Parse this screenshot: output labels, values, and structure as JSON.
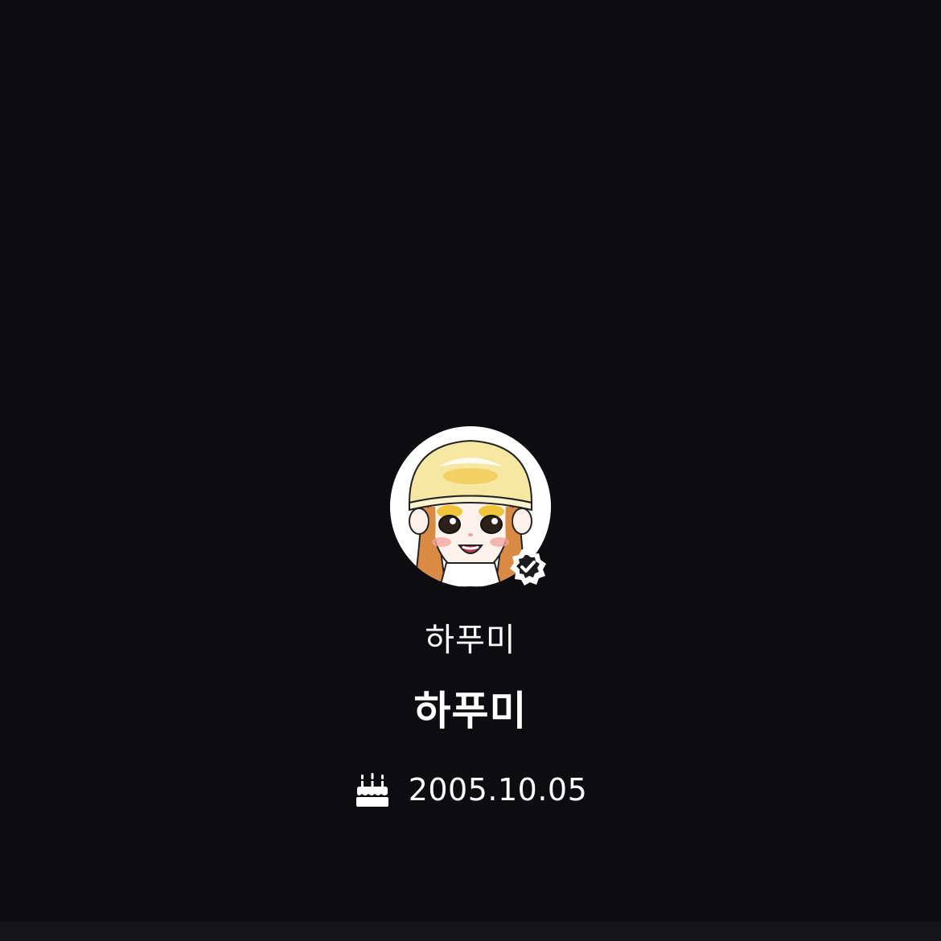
{
  "profile": {
    "nickname": "하푸미",
    "display_name": "하푸미",
    "birthday": "2005.10.05",
    "verified": true,
    "avatar": "cartoon-girl-avatar",
    "icons": {
      "birthday": "cake-icon",
      "verified": "verified-badge-icon"
    }
  },
  "colors": {
    "background": "#0d0d11",
    "text": "#ffffff",
    "hat": "#f6e7a2",
    "hair": "#d98a45"
  }
}
